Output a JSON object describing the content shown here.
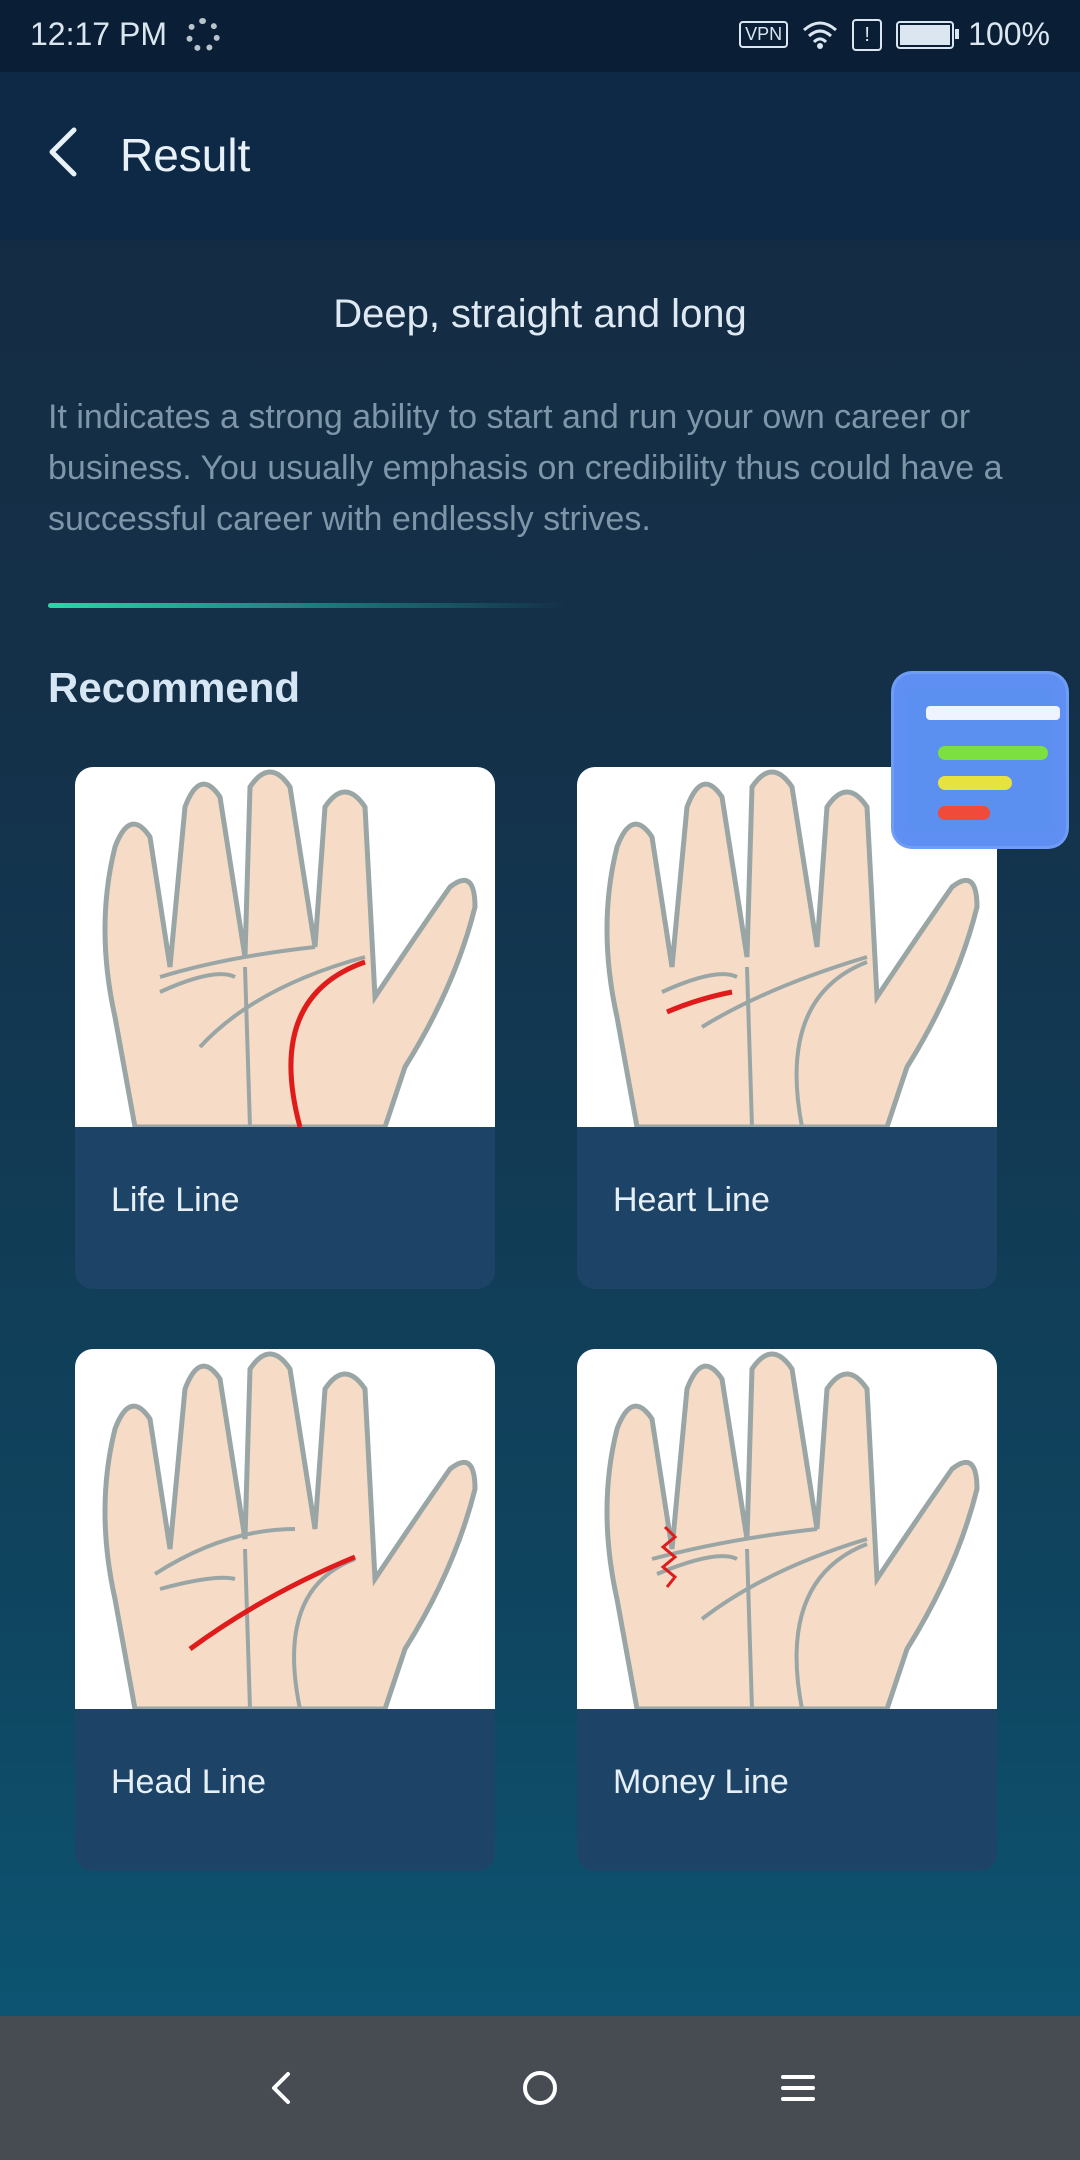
{
  "status_bar": {
    "time": "12:17 PM",
    "vpn": "VPN",
    "alert": "!",
    "battery": "100%"
  },
  "app_bar": {
    "title": "Result"
  },
  "result": {
    "title": "Deep, straight and long",
    "description": "It indicates a strong ability to start and run your own career or business. You usually emphasis on credibility thus could have a successful career with endlessly strives."
  },
  "recommend": {
    "heading": "Recommend",
    "items": [
      {
        "label": "Life Line",
        "icon": "palm-life-line-illustration"
      },
      {
        "label": "Heart Line",
        "icon": "palm-heart-line-illustration"
      },
      {
        "label": "Head Line",
        "icon": "palm-head-line-illustration"
      },
      {
        "label": "Money Line",
        "icon": "palm-money-line-illustration"
      }
    ]
  },
  "floating_widget": {
    "icon": "report-widget-icon"
  },
  "nav_bar": {
    "back": "back-icon",
    "home": "home-icon",
    "menu": "menu-icon"
  },
  "colors": {
    "accent_line": "#2ad8a8",
    "highlight_red": "#e01b1b",
    "card_bg": "#1d4466",
    "header_bg": "#0d2945"
  }
}
